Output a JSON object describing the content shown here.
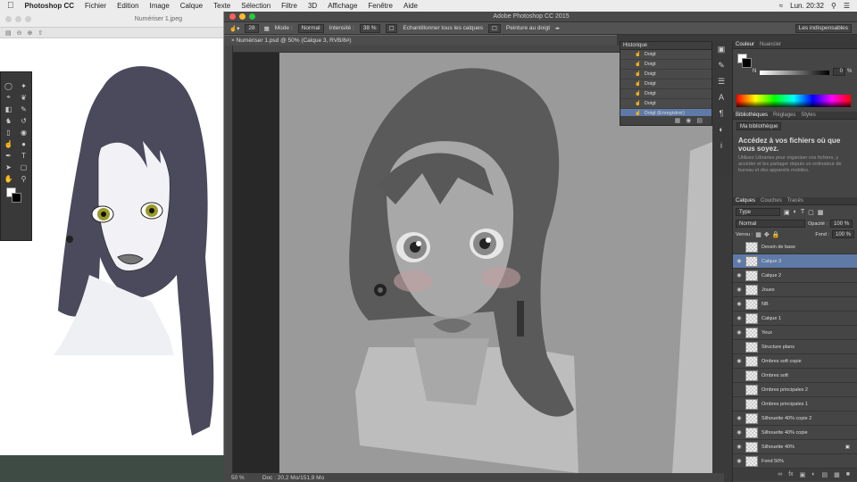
{
  "menubar": {
    "app": "Photoshop CC",
    "items": [
      "Fichier",
      "Edition",
      "Image",
      "Calque",
      "Texte",
      "Sélection",
      "Filtre",
      "3D",
      "Affichage",
      "Fenêtre",
      "Aide"
    ],
    "clock": "Lun. 20:32"
  },
  "preview": {
    "title": "Numériser 1.jpeg"
  },
  "ps": {
    "window_title": "Adobe Photoshop CC 2015",
    "doc_tab": "Numériser 1.psd @ 50% (Calque 3, RVB/8#)",
    "options": {
      "brush_size": "28",
      "mode_label": "Mode :",
      "mode_value": "Normal",
      "intensity_label": "Intensité :",
      "intensity_value": "38 %",
      "sample_all": "Echantillonner tous les calques",
      "finger_paint": "Peinture au doigt",
      "workspace": "Les indispensables"
    },
    "status": {
      "zoom": "50 %",
      "doc": "Doc : 20,2 Mo/151,9 Mo"
    }
  },
  "history": {
    "title": "Historique",
    "rows": [
      "Doigt",
      "Doigt",
      "Doigt",
      "Doigt",
      "Doigt",
      "Doigt",
      "Doigt (Enregistrer)"
    ]
  },
  "color_panel": {
    "tabs": [
      "Couleur",
      "Nuancier"
    ],
    "channel": "N",
    "value": "0",
    "unit": "%"
  },
  "library_panel": {
    "tabs": [
      "Bibliothèques",
      "Réglages",
      "Styles"
    ],
    "library": "Ma bibliothèque",
    "heading": "Accédez à vos fichiers où que vous soyez.",
    "body": "Utilisez Libraries pour organiser vos fichiers, y accéder et les partager depuis un ordinateur de bureau et des appareils mobiles."
  },
  "layers_panel": {
    "tabs": [
      "Calques",
      "Couches",
      "Tracés"
    ],
    "filter": "Type",
    "blend": "Normal",
    "opacity_label": "Opacité :",
    "opacity": "100 %",
    "lock_label": "Verrou :",
    "fill_label": "Fond :",
    "fill": "100 %",
    "layers": [
      {
        "name": "Dessin de base",
        "visible": false,
        "selected": false
      },
      {
        "name": "Calque 3",
        "visible": true,
        "selected": true
      },
      {
        "name": "Calque 2",
        "visible": true,
        "selected": false
      },
      {
        "name": "Joues",
        "visible": true,
        "selected": false
      },
      {
        "name": "NB",
        "visible": true,
        "selected": false
      },
      {
        "name": "Calque 1",
        "visible": true,
        "selected": false
      },
      {
        "name": "Yeux",
        "visible": true,
        "selected": false
      },
      {
        "name": "Structure plans",
        "visible": false,
        "selected": false
      },
      {
        "name": "Ombres soft copie",
        "visible": true,
        "selected": false
      },
      {
        "name": "Ombres soft",
        "visible": false,
        "selected": false
      },
      {
        "name": "Ombres principales 2",
        "visible": false,
        "selected": false
      },
      {
        "name": "Ombres principales 1",
        "visible": false,
        "selected": false
      },
      {
        "name": "Silhouette 40% copie 2",
        "visible": true,
        "selected": false
      },
      {
        "name": "Silhouette 40% copie",
        "visible": true,
        "selected": false
      },
      {
        "name": "Silhouette 40%",
        "visible": true,
        "selected": false,
        "locked": true
      },
      {
        "name": "Fond 50%",
        "visible": true,
        "selected": false
      }
    ]
  }
}
